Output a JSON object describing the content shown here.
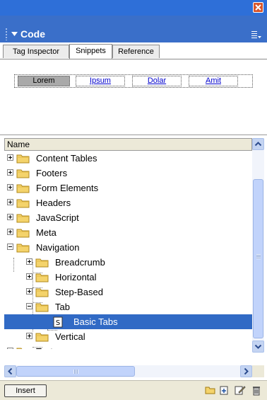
{
  "panel": {
    "title": "Code"
  },
  "tabs": [
    {
      "label": "Tag Inspector",
      "active": false
    },
    {
      "label": "Snippets",
      "active": true
    },
    {
      "label": "Reference",
      "active": false
    }
  ],
  "preview": {
    "items": [
      "Lorem",
      "Ipsum",
      "Dolar",
      "Amit"
    ]
  },
  "list": {
    "column_header": "Name",
    "items": [
      {
        "label": "Content Tables",
        "level": 0,
        "type": "folder",
        "expander": "plus"
      },
      {
        "label": "Footers",
        "level": 0,
        "type": "folder",
        "expander": "plus"
      },
      {
        "label": "Form Elements",
        "level": 0,
        "type": "folder",
        "expander": "plus"
      },
      {
        "label": "Headers",
        "level": 0,
        "type": "folder",
        "expander": "plus"
      },
      {
        "label": "JavaScript",
        "level": 0,
        "type": "folder",
        "expander": "plus"
      },
      {
        "label": "Meta",
        "level": 0,
        "type": "folder",
        "expander": "plus"
      },
      {
        "label": "Navigation",
        "level": 0,
        "type": "folder",
        "expander": "minus"
      },
      {
        "label": "Breadcrumb",
        "level": 1,
        "type": "folder",
        "expander": "plus"
      },
      {
        "label": "Horizontal",
        "level": 1,
        "type": "folder",
        "expander": "plus"
      },
      {
        "label": "Step-Based",
        "level": 1,
        "type": "folder",
        "expander": "plus"
      },
      {
        "label": "Tab",
        "level": 1,
        "type": "folder",
        "expander": "minus"
      },
      {
        "label": "Basic Tabs",
        "level": 2,
        "type": "snippet",
        "selected": true
      },
      {
        "label": "Vertical",
        "level": 1,
        "type": "folder",
        "expander": "plus"
      },
      {
        "label": "Text",
        "level": 0,
        "type": "folder",
        "expander": "plus"
      }
    ]
  },
  "bottom_toolbar": {
    "insert_label": "Insert",
    "icons": [
      "new-folder-icon",
      "new-snippet-icon",
      "edit-snippet-icon",
      "delete-icon"
    ]
  },
  "colors": {
    "panel_header": "#3a6fc9",
    "selection": "#316ac5",
    "folder": "#f4d36b",
    "close_button": "#d9562b"
  }
}
